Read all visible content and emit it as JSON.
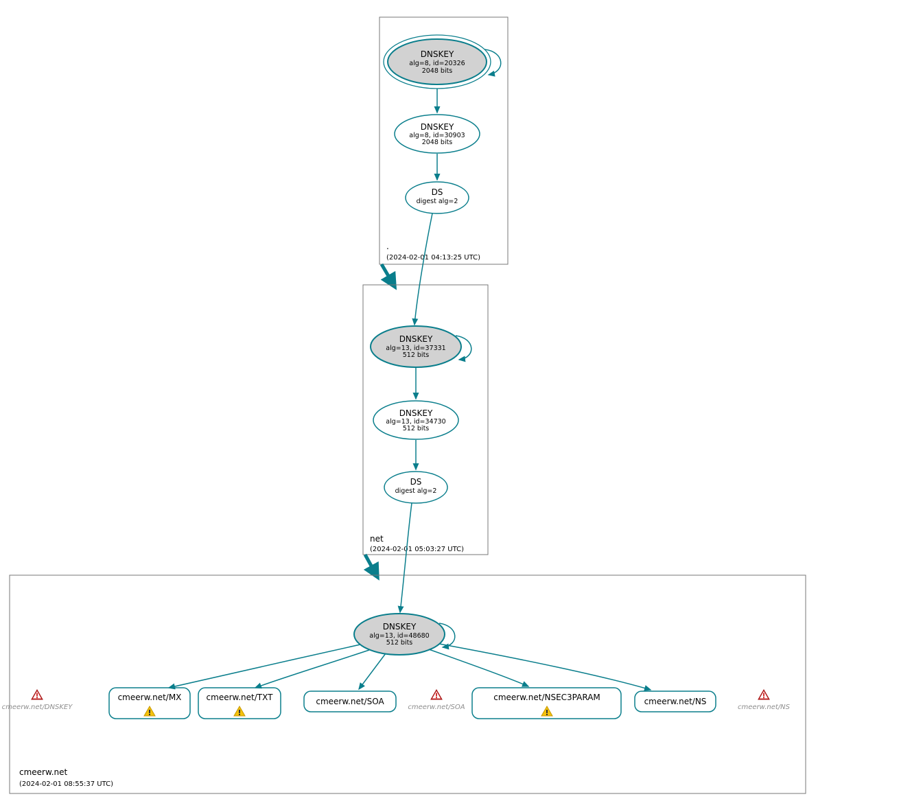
{
  "colors": {
    "accent": "#0a7e8c",
    "ksk_fill": "#d2d2d2"
  },
  "zones": {
    "root": {
      "name": ".",
      "date": "(2024-02-01 04:13:25 UTC)"
    },
    "net": {
      "name": "net",
      "date": "(2024-02-01 05:03:27 UTC)"
    },
    "leaf": {
      "name": "cmeerw.net",
      "date": "(2024-02-01 08:55:37 UTC)"
    }
  },
  "nodes": {
    "root_ksk": {
      "title": "DNSKEY",
      "l2": "alg=8, id=20326",
      "l3": "2048 bits"
    },
    "root_zsk": {
      "title": "DNSKEY",
      "l2": "alg=8, id=30903",
      "l3": "2048 bits"
    },
    "root_ds": {
      "title": "DS",
      "l2": "digest alg=2"
    },
    "net_ksk": {
      "title": "DNSKEY",
      "l2": "alg=13, id=37331",
      "l3": "512 bits"
    },
    "net_zsk": {
      "title": "DNSKEY",
      "l2": "alg=13, id=34730",
      "l3": "512 bits"
    },
    "net_ds": {
      "title": "DS",
      "l2": "digest alg=2"
    },
    "leaf_ksk": {
      "title": "DNSKEY",
      "l2": "alg=13, id=48680",
      "l3": "512 bits"
    },
    "mx": {
      "title": "cmeerw.net/MX"
    },
    "txt": {
      "title": "cmeerw.net/TXT"
    },
    "soa": {
      "title": "cmeerw.net/SOA"
    },
    "n3p": {
      "title": "cmeerw.net/NSEC3PARAM"
    },
    "ns": {
      "title": "cmeerw.net/NS"
    }
  },
  "errors": {
    "e_dnskey": "cmeerw.net/DNSKEY",
    "e_soa": "cmeerw.net/SOA",
    "e_ns": "cmeerw.net/NS"
  }
}
